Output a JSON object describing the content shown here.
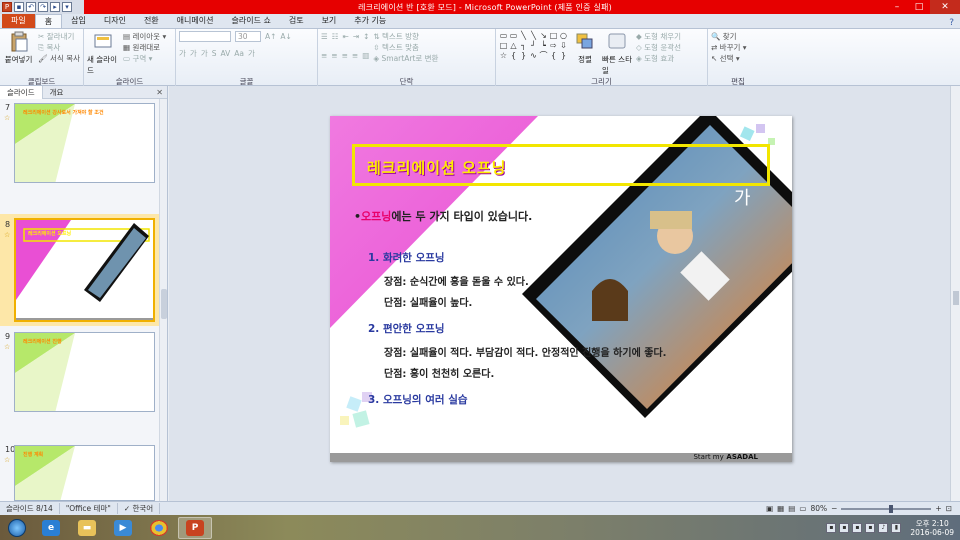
{
  "window": {
    "title": "레크리에이션 반 [호환 모드] - Microsoft PowerPoint (제품 인증 실패)"
  },
  "tabs": [
    {
      "label": "파일"
    },
    {
      "label": "홈"
    },
    {
      "label": "삽입"
    },
    {
      "label": "디자인"
    },
    {
      "label": "전환"
    },
    {
      "label": "애니메이션"
    },
    {
      "label": "슬라이드 쇼"
    },
    {
      "label": "검토"
    },
    {
      "label": "보기"
    },
    {
      "label": "추가 기능"
    }
  ],
  "ribbon": {
    "clipboard": {
      "paste": "붙여넣기",
      "cut": "잘라내기",
      "copy": "복사",
      "format_painter": "서식 복사",
      "label": "클립보드"
    },
    "slides": {
      "new_slide": "새 슬라이드",
      "layout": "레이아웃",
      "reset": "원래대로",
      "section": "구역",
      "label": "슬라이드"
    },
    "font": {
      "size": "30",
      "label": "글꼴"
    },
    "paragraph": {
      "text_direction": "텍스트 방향",
      "align_text": "텍스트 맞춤",
      "smartart": "SmartArt로 변환",
      "label": "단락"
    },
    "drawing": {
      "arrange": "정렬",
      "quick_styles": "빠른 스타일",
      "fill": "도형 채우기",
      "outline": "도형 윤곽선",
      "effects": "도형 효과",
      "label": "그리기"
    },
    "editing": {
      "find": "찾기",
      "replace": "바꾸기",
      "select": "선택",
      "label": "편집"
    }
  },
  "left_panel": {
    "tabs": [
      {
        "label": "슬라이드"
      },
      {
        "label": "개요"
      }
    ],
    "thumbnails": [
      {
        "num": "7",
        "title": "레크리에이션 강사로서 가져야 할 조건"
      },
      {
        "num": "8",
        "title": "레크리에이션 오프닝"
      },
      {
        "num": "9",
        "title": "레크리에이션 진행"
      },
      {
        "num": "10",
        "title": "진행 계획"
      }
    ]
  },
  "slide": {
    "title": "레크리에이션 오프닝",
    "bullet_highlight": "오프닝",
    "bullet_rest": "에는 두 가지 타입이 있습니다.",
    "item1": "1. 화려한 오프닝",
    "item1_pros": "장점: 순식간에 흥을 돋울 수 있다.",
    "item1_cons": "단점: 실패율이 높다.",
    "item2": "2. 편안한 오프닝",
    "item2_pros": "장점: 실패율이 적다. 부담감이 적다. 안정적인 진행을 하기에 좋다.",
    "item2_cons": "단점: 흥이 천천히 오른다.",
    "item3": "3. 오프닝의 여러 실습",
    "footer_plain": "Start my business ",
    "footer_bold": "ASADAL"
  },
  "status": {
    "slide_pos": "슬라이드 8/14",
    "theme": "\"Office 테마\"",
    "language": "한국어",
    "zoom": "80%"
  },
  "taskbar": {
    "time": "오후 2:10",
    "date": "2016-06-09"
  },
  "colors": {
    "accent_magenta": "#e94fd4",
    "title_yellow": "#ffee00",
    "file_tab": "#d24a1a",
    "titlebar_red": "#e60000"
  }
}
